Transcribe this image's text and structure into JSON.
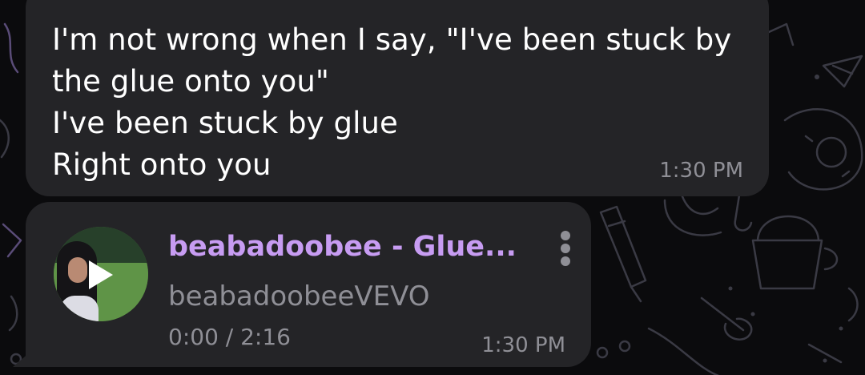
{
  "message_text": {
    "lines": [
      "I'm not wrong when I say, \"I've been stuck by",
      "the glue onto you\"",
      "I've been stuck by glue",
      "Right onto you"
    ],
    "time": "1:30 PM"
  },
  "audio_message": {
    "title": "beabadoobee - Glue...",
    "artist": "beabadoobeeVEVO",
    "progress": "0:00 / 2:16",
    "time": "1:30 PM",
    "play_icon": "play-icon",
    "menu_icon": "more-vertical-icon"
  },
  "colors": {
    "background": "#0b0b0d",
    "bubble": "#242427",
    "title_accent": "#c79cf2",
    "secondary_text": "#8f8f96"
  }
}
